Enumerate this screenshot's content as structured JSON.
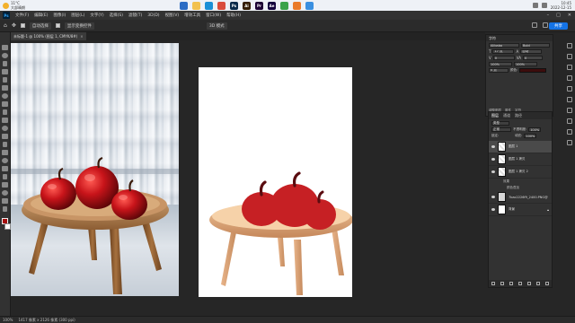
{
  "taskbar": {
    "weather_temp": "11°C",
    "weather_desc": "大部晴朗",
    "time": "10:45",
    "date": "2022-12-15",
    "apps": [
      {
        "name": "search-icon",
        "color": "#2b6cc4",
        "glyph": ""
      },
      {
        "name": "file-explorer-icon",
        "color": "#f2c14e",
        "glyph": ""
      },
      {
        "name": "edge-icon",
        "color": "#1a8fd6",
        "glyph": ""
      },
      {
        "name": "chrome-icon",
        "color": "#d94c3c",
        "glyph": ""
      },
      {
        "name": "photoshop-icon",
        "color": "#0a2a4a",
        "glyph": "Ps"
      },
      {
        "name": "illustrator-icon",
        "color": "#331c00",
        "glyph": "Ai"
      },
      {
        "name": "premiere-icon",
        "color": "#1c0033",
        "glyph": "Pr"
      },
      {
        "name": "aftereffects-icon",
        "color": "#13003d",
        "glyph": "Ae"
      },
      {
        "name": "app-green-icon",
        "color": "#3aa34a",
        "glyph": ""
      },
      {
        "name": "app-orange-icon",
        "color": "#ea7a2a",
        "glyph": ""
      },
      {
        "name": "app-blue-icon",
        "color": "#3a8fe0",
        "glyph": ""
      }
    ]
  },
  "menu": {
    "items": [
      "文件(F)",
      "编辑(E)",
      "图像(I)",
      "图层(L)",
      "文字(Y)",
      "选择(S)",
      "滤镜(T)",
      "3D(D)",
      "视图(V)",
      "增效工具",
      "窗口(W)",
      "帮助(H)"
    ]
  },
  "options": {
    "auto_select": "自动选择",
    "transform": "显示变换控件",
    "mode_3d": "3D 模式",
    "share": "共享"
  },
  "document": {
    "tab": "未标题-1 @ 100% (图层 1, CMYK/8#)",
    "status_zoom": "100%",
    "status_info": "1417 像素 x 2126 像素 (300 ppi)"
  },
  "properties": {
    "title": "字符",
    "font": "Alibaba",
    "style": "Bold",
    "size": "17 点",
    "leading": "自动",
    "kerning": "0",
    "tracking": "0",
    "scale_v": "100%",
    "scale_h": "100%",
    "baseline": "0 点",
    "color_label": "颜色:",
    "tab1": "调整图层",
    "tab2": "属性",
    "tab3": "字符"
  },
  "layers_panel": {
    "tabs": [
      "图层",
      "通道",
      "路径"
    ],
    "kind": "类型",
    "mode": "正常",
    "opacity_label": "不透明度:",
    "opacity": "100%",
    "fill_label": "填充:",
    "fill": "100%",
    "lock_label": "锁定:",
    "layers": [
      {
        "name": "图层 1",
        "selected": true
      },
      {
        "name": "图层 1 拷贝",
        "selected": false
      },
      {
        "name": "图层 1 拷贝 2",
        "selected": false
      },
      {
        "name": "7bac2226f9_2400.PNG@2x",
        "selected": false
      },
      {
        "name": "背景",
        "selected": false
      }
    ],
    "effects_label": "效果",
    "effect_item": "颜色叠加"
  },
  "colors": {
    "accent": "#1473e6",
    "apple_red": "#c62024",
    "apple_dark": "#5a0c10",
    "table_top": "#c08d5c",
    "leg": "#cf9a67"
  }
}
